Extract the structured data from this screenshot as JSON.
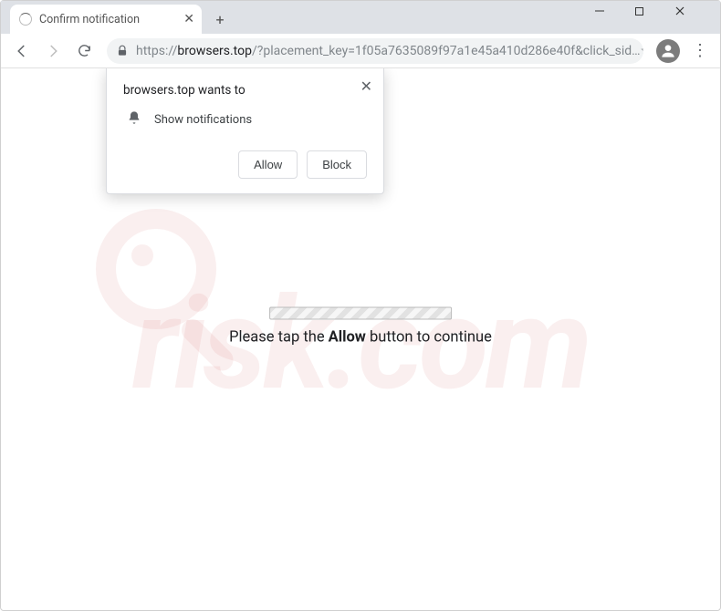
{
  "window": {
    "minimize_glyph": "—",
    "maximize_glyph": "▢",
    "close_glyph": "✕"
  },
  "tab": {
    "title": "Confirm notification",
    "close_glyph": "✕",
    "newtab_glyph": "+"
  },
  "toolbar": {
    "url_scheme": "https://",
    "url_host": "browsers.top",
    "url_path": "/?placement_key=1f05a7635089f97a1e45a410d286e40f&click_sid…",
    "star_glyph": "☆",
    "menu_glyph": "⋮"
  },
  "permission": {
    "title": "browsers.top wants to",
    "item": "Show notifications",
    "allow_label": "Allow",
    "block_label": "Block",
    "close_glyph": "✕"
  },
  "page": {
    "msg_prefix": "Please tap the ",
    "msg_bold": "Allow",
    "msg_suffix": " button to continue"
  },
  "watermark": {
    "text": "risk.com"
  }
}
